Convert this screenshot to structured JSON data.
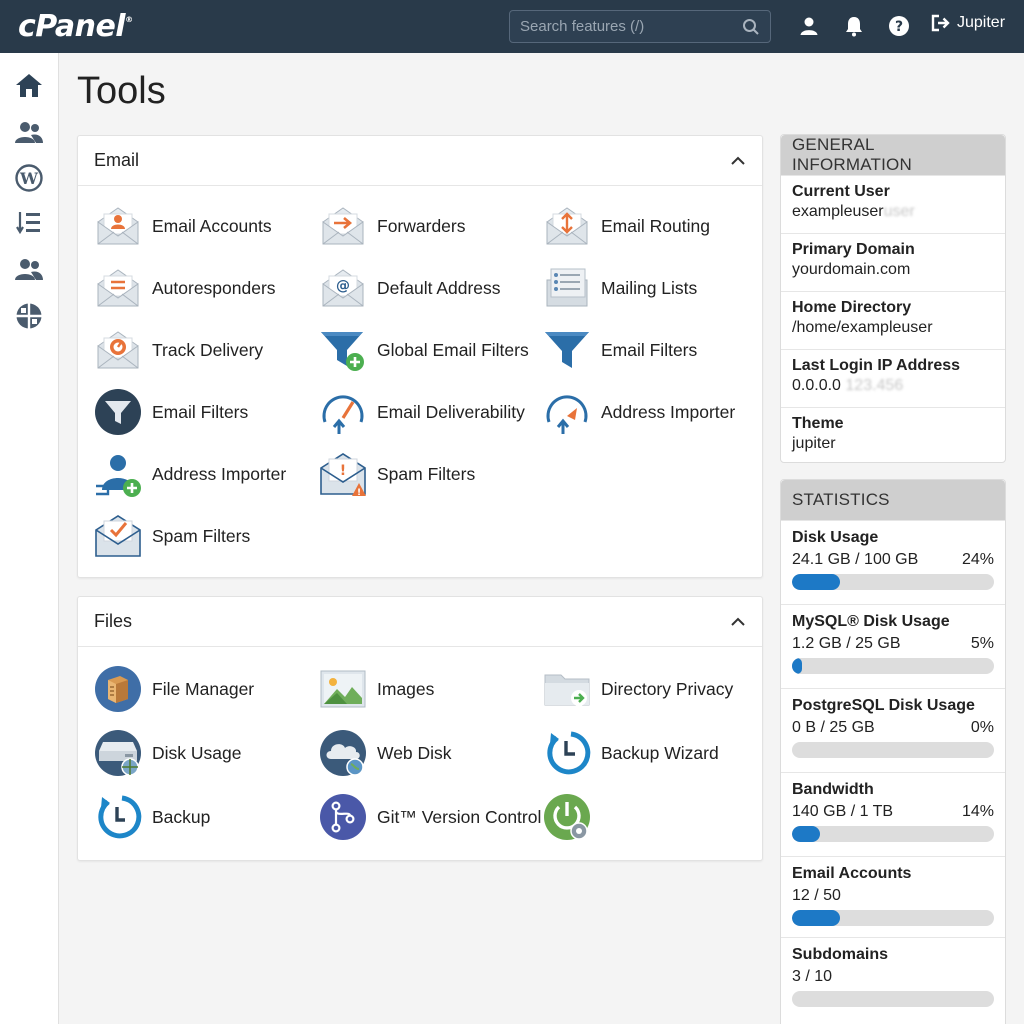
{
  "header": {
    "logo": "cPanel",
    "logo_mark": "®",
    "search_placeholder": "Search features (/)",
    "user_label": "Jupiter"
  },
  "sidebar": {
    "icons": [
      "home-icon",
      "users-icon",
      "wordpress-icon",
      "list-icon",
      "user-manager-icon",
      "globe-icon"
    ]
  },
  "page": {
    "title": "Tools"
  },
  "email_section": {
    "title": "Email",
    "tools": [
      {
        "label": "Email Accounts",
        "icon": "email-accounts-icon"
      },
      {
        "label": "Forwarders",
        "icon": "forwarders-icon"
      },
      {
        "label": "Email Routing",
        "icon": "email-routing-icon"
      },
      {
        "label": "Autoresponders",
        "icon": "autoresponders-icon"
      },
      {
        "label": "Default Address",
        "icon": "default-address-icon"
      },
      {
        "label": "Mailing Lists",
        "icon": "mailing-lists-icon"
      },
      {
        "label": "Track Delivery",
        "icon": "track-delivery-icon"
      },
      {
        "label": "Global Email Filters",
        "icon": "global-email-filters-icon"
      },
      {
        "label": "Email Filters",
        "icon": "email-filters-icon"
      },
      {
        "label": "Email Filters",
        "icon": "email-filters-round-icon"
      },
      {
        "label": "Email Deliverability",
        "icon": "email-deliverability-icon"
      },
      {
        "label": "Address Importer",
        "icon": "address-importer-icon"
      },
      {
        "label": "Address Importer",
        "icon": "address-importer-user-icon"
      },
      {
        "label": "Spam Filters",
        "icon": "spam-filters-icon"
      },
      {
        "label": "Spam Filters",
        "icon": "spam-filters-check-icon"
      }
    ]
  },
  "files_section": {
    "title": "Files",
    "tools": [
      {
        "label": "File Manager",
        "icon": "file-manager-icon"
      },
      {
        "label": "Images",
        "icon": "images-icon"
      },
      {
        "label": "Directory Privacy",
        "icon": "directory-privacy-icon"
      },
      {
        "label": "Disk Usage",
        "icon": "disk-usage-icon"
      },
      {
        "label": "Web Disk",
        "icon": "web-disk-icon"
      },
      {
        "label": "Backup Wizard",
        "icon": "backup-wizard-icon"
      },
      {
        "label": "Backup",
        "icon": "backup-icon"
      },
      {
        "label": "Git™ Version Control",
        "icon": "git-icon"
      },
      {
        "label": "",
        "icon": "power-settings-icon"
      }
    ]
  },
  "general_info": {
    "title": "GENERAL INFORMATION",
    "rows": [
      {
        "label": "Current User",
        "value": "exampleuser",
        "blurred": "user"
      },
      {
        "label": "Primary Domain",
        "value": "yourdomain.com",
        "blurred": ""
      },
      {
        "label": "Home Directory",
        "value": "/home/exampleuser",
        "blurred": ""
      },
      {
        "label": "Last Login IP Address",
        "value": "0.0.0.0",
        "blurred": "123.456"
      },
      {
        "label": "Theme",
        "value": "jupiter",
        "blurred": ""
      }
    ]
  },
  "statistics": {
    "title": "STATISTICS",
    "rows": [
      {
        "label": "Disk Usage",
        "value": "24.1 GB / 100 GB",
        "percent_label": "24%",
        "fraction": 0.24
      },
      {
        "label": "MySQL® Disk Usage",
        "value": "1.2 GB / 25 GB",
        "percent_label": "5%",
        "fraction": 0.05
      },
      {
        "label": "PostgreSQL Disk Usage",
        "value": "0 B / 25 GB",
        "percent_label": "0%",
        "fraction": 0.0
      },
      {
        "label": "Bandwidth",
        "value": "140 GB / 1 TB",
        "percent_label": "14%",
        "fraction": 0.14
      },
      {
        "label": "Email Accounts",
        "value": "12 / 50",
        "percent_label": "",
        "fraction": 0.24
      },
      {
        "label": "Subdomains",
        "value": "3 / 10",
        "percent_label": "",
        "fraction": 0.0
      }
    ]
  },
  "colors": {
    "topbar": "#293a4a",
    "accent_blue": "#1d79c6",
    "accent_orange": "#e8733a",
    "bar_track": "#dddddd"
  }
}
